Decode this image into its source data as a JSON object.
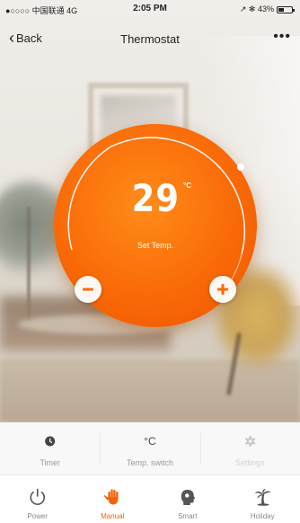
{
  "status_bar": {
    "carrier": "●○○○○ 中国联通 4G",
    "time": "2:05 PM",
    "signal": "↗ ✻ 43%"
  },
  "nav": {
    "back_label": "Back",
    "title": "Thermostat",
    "more_label": "•••"
  },
  "thermostat": {
    "set_temp": "29",
    "unit": "°C",
    "label": "Set Temp.",
    "accent_color": "#f96a07"
  },
  "functions": [
    {
      "label": "Timer",
      "icon": "clock-icon",
      "enabled": true
    },
    {
      "label": "Temp. switch",
      "icon": "celsius-icon",
      "icon_text": "°C",
      "enabled": true
    },
    {
      "label": "Settings",
      "icon": "gear-icon",
      "enabled": false
    }
  ],
  "tabs": [
    {
      "label": "Power",
      "icon": "power-icon",
      "active": false
    },
    {
      "label": "Manual",
      "icon": "hand-icon",
      "active": true
    },
    {
      "label": "Smart",
      "icon": "smart-head-icon",
      "active": false
    },
    {
      "label": "Holiday",
      "icon": "palm-tree-icon",
      "active": false
    }
  ],
  "battery_level": 0.43
}
